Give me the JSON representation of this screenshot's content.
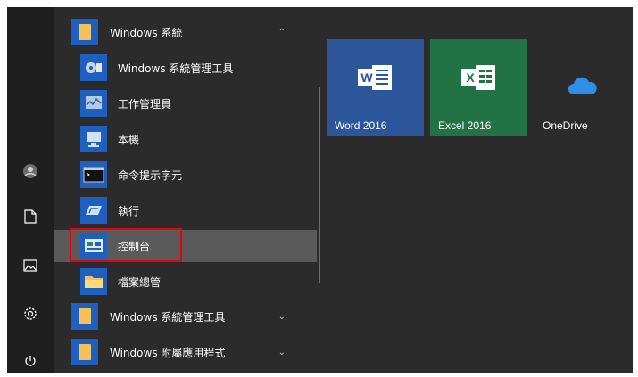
{
  "rail": {
    "icons": [
      "user-icon",
      "document-icon",
      "pictures-icon",
      "settings-icon",
      "power-icon"
    ]
  },
  "list": {
    "group_windows_system": {
      "label": "Windows 系統",
      "chevron": "⌃"
    },
    "items": [
      {
        "label": "Windows 系統管理工具",
        "icon": "admin-tools-icon"
      },
      {
        "label": "工作管理員",
        "icon": "task-manager-icon"
      },
      {
        "label": "本機",
        "icon": "this-pc-icon"
      },
      {
        "label": "命令提示字元",
        "icon": "command-prompt-icon"
      },
      {
        "label": "執行",
        "icon": "run-icon"
      },
      {
        "label": "控制台",
        "icon": "control-panel-icon"
      },
      {
        "label": "檔案總管",
        "icon": "file-explorer-icon"
      }
    ],
    "group_admin_tools": {
      "label": "Windows 系統管理工具",
      "chevron": "⌄"
    },
    "group_accessories": {
      "label": "Windows 附屬應用程式",
      "chevron": "⌄"
    }
  },
  "tiles": [
    {
      "label": "Word 2016",
      "letter": "W",
      "color": "#2b579a"
    },
    {
      "label": "Excel 2016",
      "letter": "X",
      "color": "#217346"
    },
    {
      "label": "OneDrive",
      "color": "#2b2b2b"
    }
  ],
  "colors": {
    "highlight_box": "#e3000f",
    "accent": "#1e5fbf"
  }
}
